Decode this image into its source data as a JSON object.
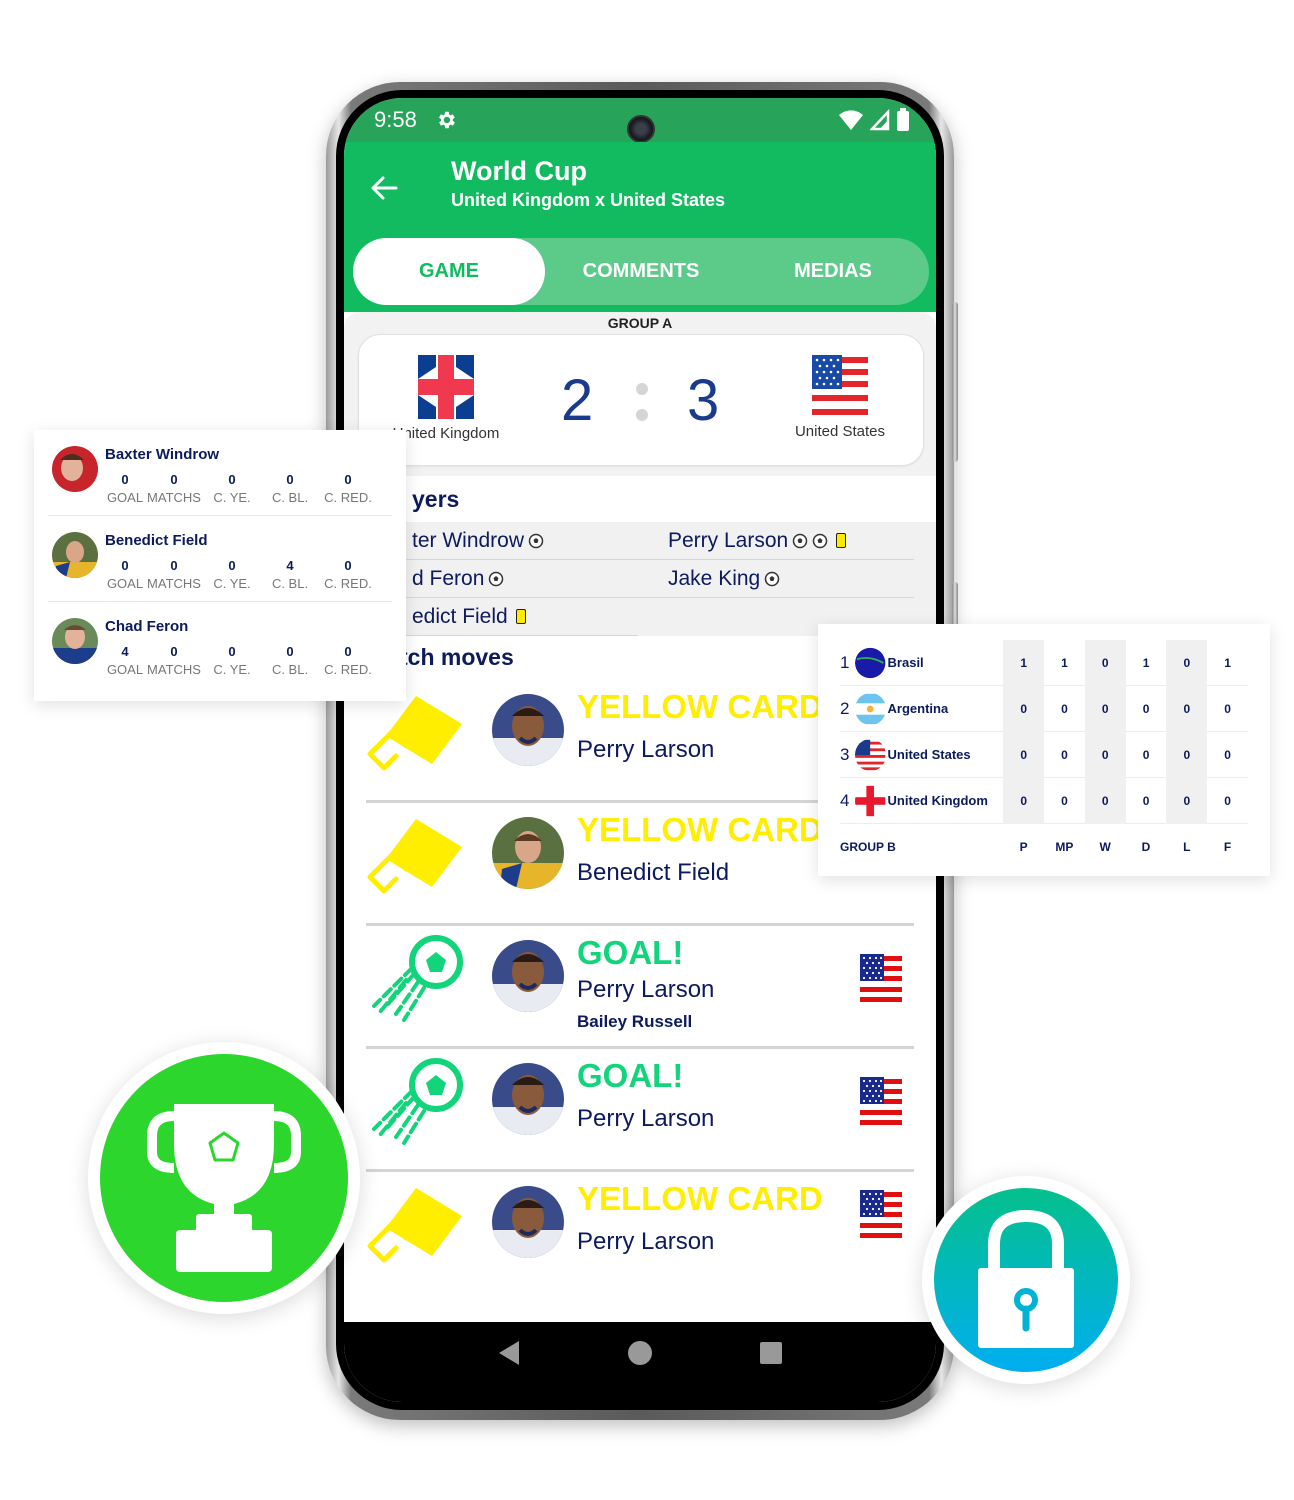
{
  "status_bar": {
    "time": "9:58",
    "icons": [
      "gear-icon",
      "wifi-icon",
      "signal-icon",
      "battery-icon"
    ]
  },
  "app_bar": {
    "title": "World Cup",
    "subtitle": "United Kingdom x United States",
    "back_icon": "arrow-left-icon"
  },
  "tabs": [
    {
      "label": "GAME",
      "active": true
    },
    {
      "label": "COMMENTS",
      "active": false
    },
    {
      "label": "MEDIAS",
      "active": false
    }
  ],
  "match": {
    "group": "GROUP A",
    "home": {
      "name": "United Kingdom",
      "score": "2",
      "flag": "uk-flag"
    },
    "away": {
      "name": "United States",
      "score": "3",
      "flag": "us-flag"
    }
  },
  "players_section": {
    "title": "Players",
    "visible_title": "yers",
    "rows": [
      {
        "left": {
          "name": "Baxter Windrow",
          "visible": "ter Windrow",
          "goals": 1,
          "yellow": 0
        },
        "right": {
          "name": "Perry Larson",
          "goals": 2,
          "yellow": 1
        }
      },
      {
        "left": {
          "name": "Chad Feron",
          "visible": "d Feron",
          "goals": 1,
          "yellow": 0
        },
        "right": {
          "name": "Jake King",
          "goals": 1,
          "yellow": 0
        }
      },
      {
        "left": {
          "name": "Benedict Field",
          "visible": "edict Field",
          "goals": 0,
          "yellow": 1
        },
        "right": null
      }
    ]
  },
  "match_moves": {
    "title": "Match moves",
    "visible_title": "tch moves",
    "items": [
      {
        "type": "YELLOW CARD",
        "kind": "yellow",
        "player": "Perry Larson",
        "assist": "",
        "flag": ""
      },
      {
        "type": "YELLOW CARD",
        "kind": "yellow",
        "player": "Benedict Field",
        "assist": "",
        "flag": ""
      },
      {
        "type": "GOAL!",
        "kind": "goal",
        "player": "Perry Larson",
        "assist": "Bailey Russell",
        "flag": "us-flag"
      },
      {
        "type": "GOAL!",
        "kind": "goal",
        "player": "Perry Larson",
        "assist": "",
        "flag": "us-flag"
      },
      {
        "type": "YELLOW CARD",
        "kind": "yellow",
        "player": "Perry Larson",
        "assist": "",
        "flag": "us-flag"
      }
    ]
  },
  "player_stats_card": {
    "labels": [
      "GOAL",
      "MATCHS",
      "C. YE.",
      "C. BL.",
      "C. RED."
    ],
    "players": [
      {
        "name": "Baxter Windrow",
        "values": [
          "0",
          "0",
          "0",
          "0",
          "0"
        ]
      },
      {
        "name": "Benedict Field",
        "values": [
          "0",
          "0",
          "0",
          "4",
          "0"
        ]
      },
      {
        "name": "Chad Feron",
        "values": [
          "4",
          "0",
          "0",
          "0",
          "0"
        ]
      }
    ]
  },
  "standings_card": {
    "group": "GROUP B",
    "headers": [
      "P",
      "MP",
      "W",
      "D",
      "L",
      "F"
    ],
    "rows": [
      {
        "rank": "1",
        "team": "Brasil",
        "values": [
          "1",
          "1",
          "0",
          "1",
          "0",
          "1"
        ]
      },
      {
        "rank": "2",
        "team": "Argentina",
        "values": [
          "0",
          "0",
          "0",
          "0",
          "0",
          "0"
        ]
      },
      {
        "rank": "3",
        "team": "United States",
        "values": [
          "0",
          "0",
          "0",
          "0",
          "0",
          "0"
        ]
      },
      {
        "rank": "4",
        "team": "United Kingdom",
        "values": [
          "0",
          "0",
          "0",
          "0",
          "0",
          "0"
        ]
      }
    ]
  },
  "badges": [
    {
      "icon": "trophy-icon",
      "color": "#2cd62c"
    },
    {
      "icon": "lock-icon",
      "color_top": "#05c08c",
      "color_bottom": "#00aef0"
    }
  ],
  "colors": {
    "primary": "#12bb60",
    "status_bar": "#27a35a",
    "tab_track": "#5ccb8a",
    "navy_text": "#0d1a5c",
    "score_blue": "#1a3a8c",
    "yellow_card": "#ffee00",
    "goal_green": "#12d47a"
  }
}
